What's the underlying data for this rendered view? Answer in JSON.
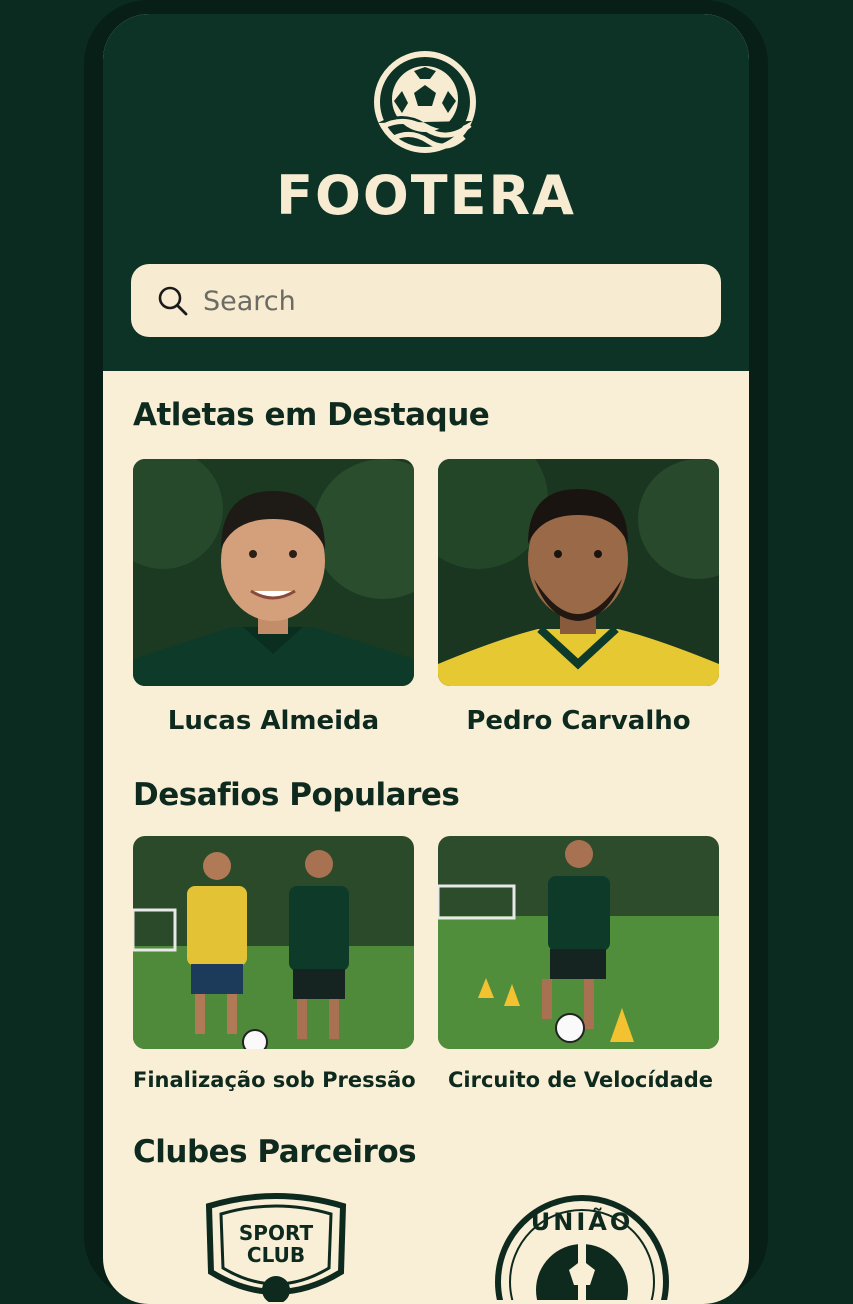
{
  "app": {
    "brand": "FOOTERA"
  },
  "search": {
    "placeholder": "Search"
  },
  "sections": {
    "featured_title": "Atletas em Destaque",
    "challenges_title": "Desafios Populares",
    "clubs_title": "Clubes Parceiros"
  },
  "athletes": [
    {
      "name": "Lucas Almeida",
      "jersey": "green"
    },
    {
      "name": "Pedro Carvalho",
      "jersey": "yellow"
    }
  ],
  "challenges": [
    {
      "name": "Finalização sob Pressão"
    },
    {
      "name": "Circuito de Velocídade"
    }
  ],
  "clubs": [
    {
      "badge_text_line1": "SPORT",
      "badge_text_line2": "CLUB",
      "icon": "shield-badge-icon"
    },
    {
      "badge_text": "UNIÃO",
      "icon": "round-badge-icon"
    }
  ],
  "colors": {
    "header_bg": "#0d3326",
    "content_bg": "#f8efd6",
    "text_dark": "#0e2a1f",
    "cream": "#f7ecd2"
  }
}
